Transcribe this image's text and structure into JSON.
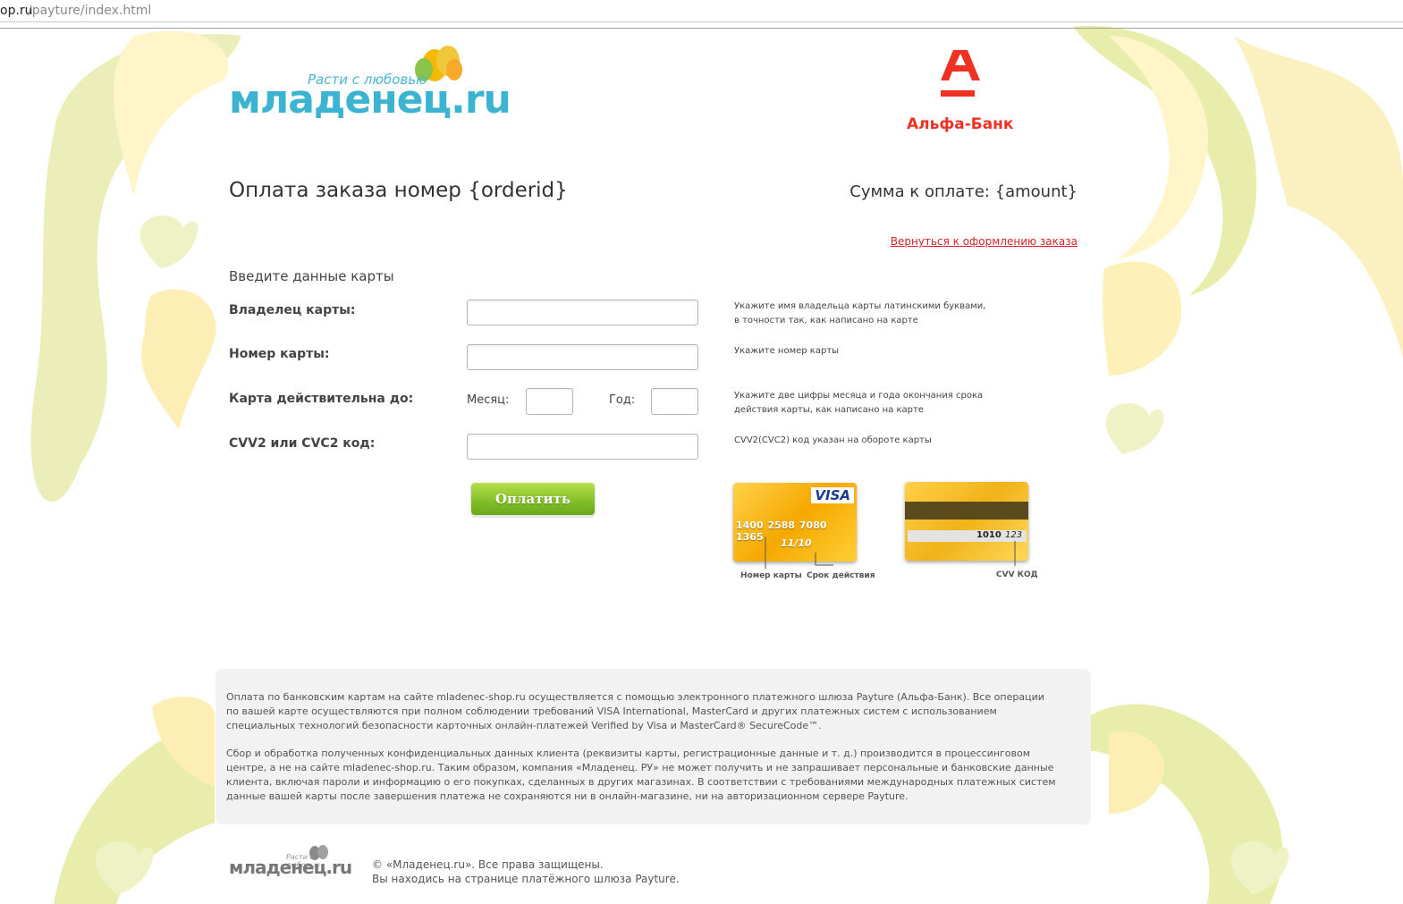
{
  "browser": {
    "url_host": "op.ru",
    "url_path": "/payture/index.html"
  },
  "brand": {
    "logo_text": "младенец.ru",
    "tagline": "Расти с любовью",
    "bank_name": "Альфа-Банк",
    "bank_letter": "А",
    "bank_color": "#ef3124",
    "logo_color": "#3bb3d1"
  },
  "order": {
    "title": "Оплата заказа номер {orderid}",
    "amount": "Сумма к оплате: {amount}",
    "return_link": "Вернуться к оформлению заказа"
  },
  "form": {
    "heading": "Введите данные карты",
    "holder_label": "Владелец карты:",
    "number_label": "Номер карты:",
    "expiry_label": "Карта действительна до:",
    "month_label": "Месяц:",
    "year_label": "Год:",
    "cvv_label": "CVV2 или CVC2 код:",
    "holder_value": "",
    "number_value": "",
    "month_value": "",
    "year_value": "",
    "cvv_value": "",
    "pay_button": "Оплатить"
  },
  "hints": {
    "holder_line1": "Укажите имя владельца карты латинскими буквами,",
    "holder_line2": "в точности так, как написано на карте",
    "number": "Укажите номер карты",
    "expiry_line1": "Укажите две цифры месяца и года окончания срока",
    "expiry_line2": "действия карты, как написано на карте",
    "cvv": "CVV2(CVC2) код указан на обороте карты"
  },
  "card_sample": {
    "brand": "VISA",
    "number": "1400 2588 7080 1365",
    "expiry": "11/10",
    "caption_number": "Номер карты",
    "caption_expiry": "Срок действия",
    "back_number": "1010",
    "back_cvv": "123",
    "caption_cvv": "CVV КОД"
  },
  "info": {
    "p1_line1": "Оплата по банковским картам на сайте mladenec-shop.ru осуществляется с помощью электронного платежного шлюза Payture (Альфа-Банк). Все операции",
    "p1_line2": "по вашей карте осуществляются при полном соблюдении требований VISA International, MasterCard и других платежных систем с использованием",
    "p1_line3": "специальных технологий безопасности карточных онлайн-платежей Verified by Visa и MasterCard® SecureCode™.",
    "p2_line1": "Сбор и обработка полученных конфиденциальных данных клиента (реквизиты карты, регистрационные данные и т. д.) производится в процессинговом",
    "p2_line2": "центре, а не на сайте mladenec-shop.ru. Таким образом, компания «Младенец. РУ» не может получить и не запрашивает персональные и банковские данные",
    "p2_line3": "клиента, включая пароли и информацию о его покупках, сделанных в других магазинах. В соответствии с требованиями международных платежных систем",
    "p2_line4": "данные вашей карты после завершения платежа не сохраняются ни в онлайн-магазине, ни на авторизационном сервере Payture."
  },
  "footer": {
    "logo_text": "младенец.ru",
    "tagline": "Расти с любовью",
    "copyright": "© «Младенец.ru». Все права защищены.",
    "gateway_note": "Вы находись на странице платёжного шлюза Payture."
  }
}
